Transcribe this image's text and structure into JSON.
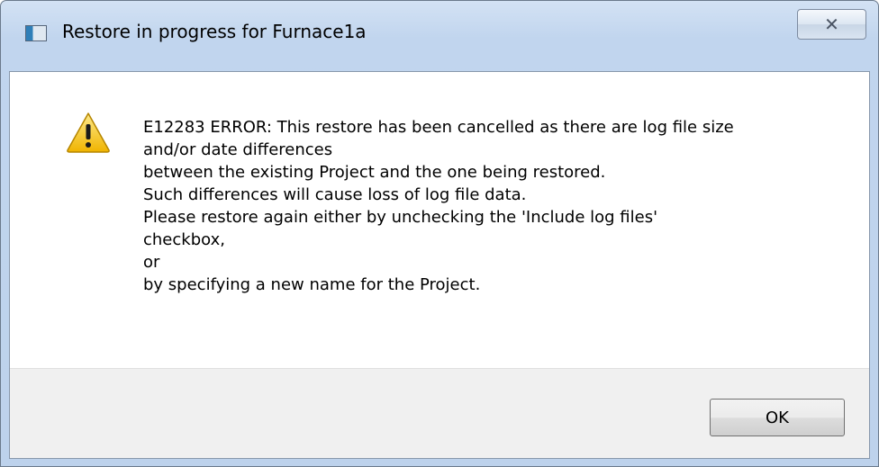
{
  "window": {
    "title": "Restore in progress for Furnace1a",
    "close_glyph": "✕"
  },
  "icons": {
    "title_icon": "application-window-icon",
    "warning": "warning-icon"
  },
  "message": {
    "lines": [
      "E12283 ERROR: This restore has been cancelled as there are log file size",
      "and/or date differences",
      "between the existing Project and the one being restored.",
      "Such differences will cause loss of log file data.",
      "Please restore again either by unchecking the 'Include log files'",
      "checkbox,",
      "or",
      "by specifying a new name for the Project."
    ]
  },
  "buttons": {
    "ok_label": "OK"
  },
  "colors": {
    "title_bar": "#c1d5ee",
    "footer": "#f0f0f0",
    "warning_fill": "#f3c11a"
  }
}
